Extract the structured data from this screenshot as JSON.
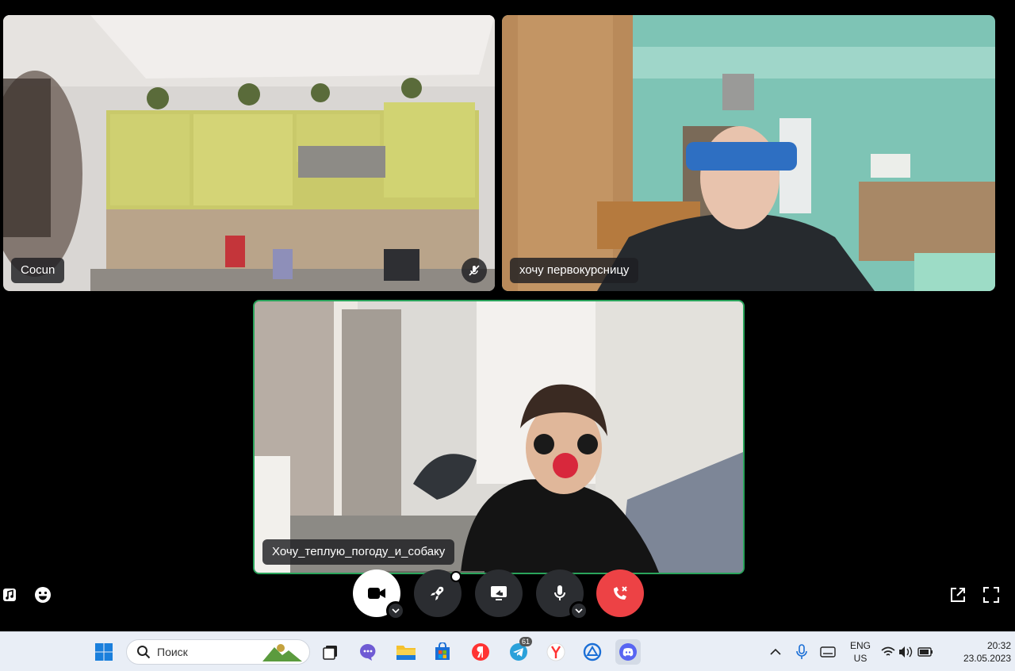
{
  "participants": [
    {
      "name": "Cocun"
    },
    {
      "name": "хочу первокурсницу"
    },
    {
      "name": "Хочу_теплую_погоду_и_собаку"
    }
  ],
  "taskbar": {
    "search_placeholder": "Поиск",
    "telegram_badge": "61",
    "lang_line1": "ENG",
    "lang_line2": "US",
    "time": "20:32",
    "date": "23.05.2023"
  },
  "colors": {
    "active_speaker_border": "#2aa45b",
    "end_call": "#ed4245",
    "control_dark": "#2b2d31"
  }
}
